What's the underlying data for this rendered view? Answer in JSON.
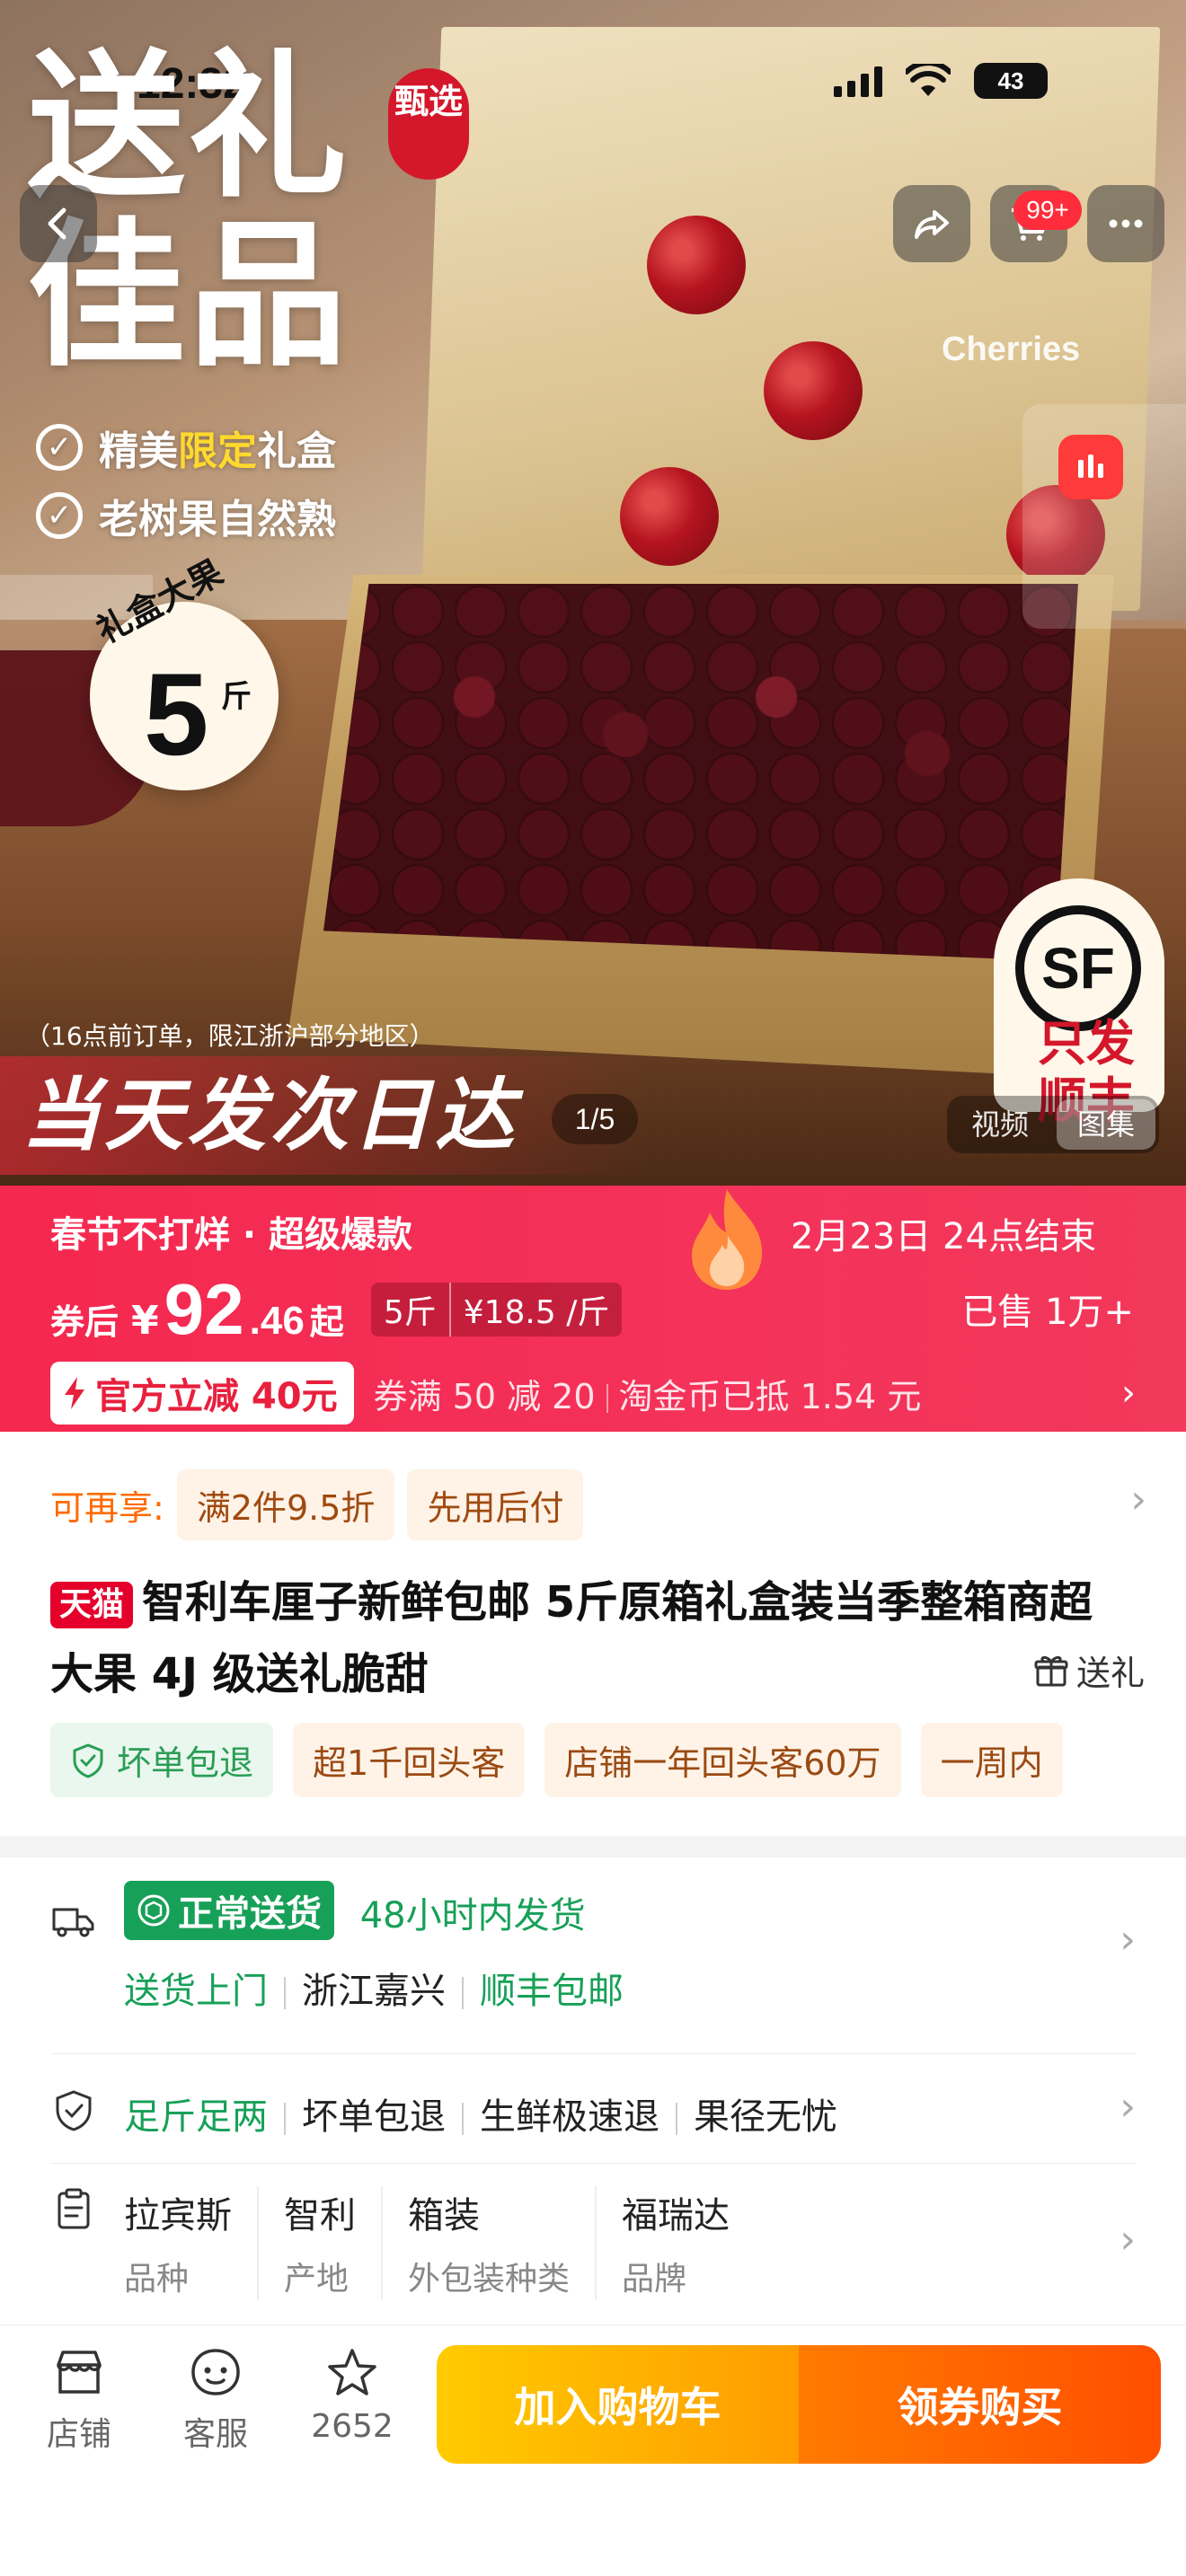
{
  "status_bar": {
    "time": "12:32",
    "battery": "43"
  },
  "hero": {
    "promo_title_line1": "送礼",
    "promo_title_line2": "佳品",
    "badge_select": "甄选",
    "feature1_prefix": "精美",
    "feature1_highlight": "限定",
    "feature1_suffix": "礼盒",
    "feature2": "老树果自然熟",
    "big_fruit_label": "礼盒大果",
    "big_fruit_num": "5",
    "big_fruit_unit": "斤",
    "lid_brand": "Cherries",
    "sf_logo": "SF",
    "sf_text": "只发顺丰",
    "order_note": "（16点前订单，限江浙沪部分地区）",
    "same_day": "当天发次日达",
    "counter": "1/5",
    "media_tabs": [
      "视频",
      "图集"
    ],
    "cart_badge": "99+"
  },
  "price_bar": {
    "festival": "春节不打烊 · 超级爆款",
    "deadline": "2月23日 24点结束",
    "price_prefix": "券后",
    "currency": "¥",
    "price_int": "92",
    "price_dec": ".46",
    "price_suffix": "起",
    "unit_weight": "5斤",
    "unit_price": "¥18.5 /斤",
    "sold": "已售 1万+",
    "official_discount": "官方立减 40元",
    "coupon1": "券满 50 减 20",
    "coupon2": "淘金币已抵 1.54 元"
  },
  "product": {
    "enjoy_label": "可再享:",
    "enjoy_chips": [
      "满2件9.5折",
      "先用后付"
    ],
    "store_tag": "天猫",
    "title": "智利车厘子新鲜包邮 5斤原箱礼盒装当季整箱商超大果 4J 级送礼脆甜",
    "gift": "送礼",
    "tags": [
      "坏单包退",
      "超1千回头客",
      "店铺一年回头客60万",
      "一周内"
    ]
  },
  "service": {
    "delivery_badge": "正常送货",
    "delivery_time": "48小时内发货",
    "door": "送货上门",
    "origin": "浙江嘉兴",
    "shipping": "顺丰包邮",
    "guarantee1": "足斤足两",
    "guarantee2": "坏单包退",
    "guarantee3": "生鲜极速退",
    "guarantee4": "果径无忧",
    "specs": [
      {
        "v": "拉宾斯",
        "k": "品种"
      },
      {
        "v": "智利",
        "k": "产地"
      },
      {
        "v": "箱装",
        "k": "外包装种类"
      },
      {
        "v": "福瑞达",
        "k": "品牌"
      }
    ]
  },
  "bottom_bar": {
    "store": "店铺",
    "service": "客服",
    "favorites": "2652",
    "add_to_cart": "加入购物车",
    "buy": "领券购买"
  },
  "colors": {
    "price_bar": "#f4325a",
    "tmall_red": "#e4002b",
    "service_green": "#17a058",
    "cta_yellow": "#ffb300",
    "cta_orange": "#ff5a00"
  }
}
